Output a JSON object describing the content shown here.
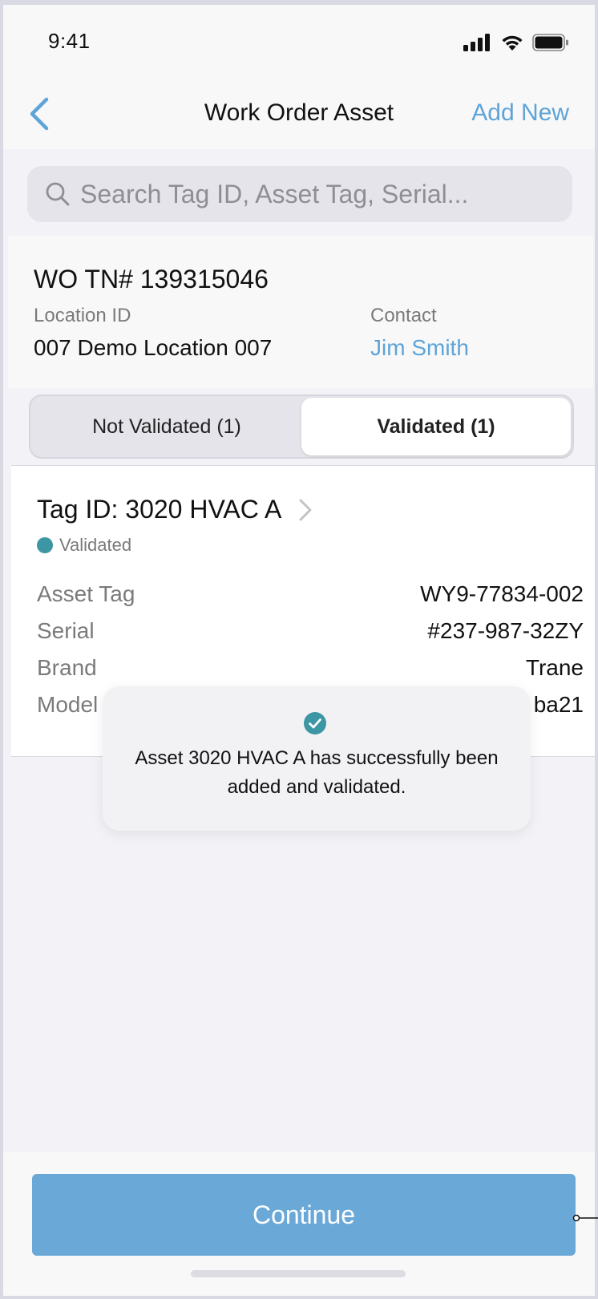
{
  "status_bar": {
    "time": "9:41"
  },
  "nav": {
    "title": "Work Order Asset",
    "action": "Add New"
  },
  "search": {
    "placeholder": "Search Tag ID, Asset Tag, Serial..."
  },
  "work_order": {
    "number": "WO TN# 139315046",
    "location_label": "Location ID",
    "location_value": "007 Demo Location 007",
    "contact_label": "Contact",
    "contact_value": "Jim Smith"
  },
  "tabs": [
    {
      "label": "Not Validated (1)",
      "active": false
    },
    {
      "label": "Validated (1)",
      "active": true
    }
  ],
  "asset": {
    "title": "Tag ID: 3020 HVAC A",
    "status": "Validated",
    "status_color": "#3d96a3",
    "fields": [
      {
        "label": "Asset Tag",
        "value": "WY9-77834-002"
      },
      {
        "label": "Serial",
        "value": "#237-987-32ZY"
      },
      {
        "label": "Brand",
        "value": "Trane"
      },
      {
        "label": "Model",
        "value": "ba21"
      }
    ]
  },
  "toast": {
    "message": "Asset 3020 HVAC A has successfully been added and validated."
  },
  "footer": {
    "button": "Continue"
  },
  "colors": {
    "accent": "#5ea4d9",
    "button": "#6aa8d8",
    "success": "#3d96a3"
  }
}
